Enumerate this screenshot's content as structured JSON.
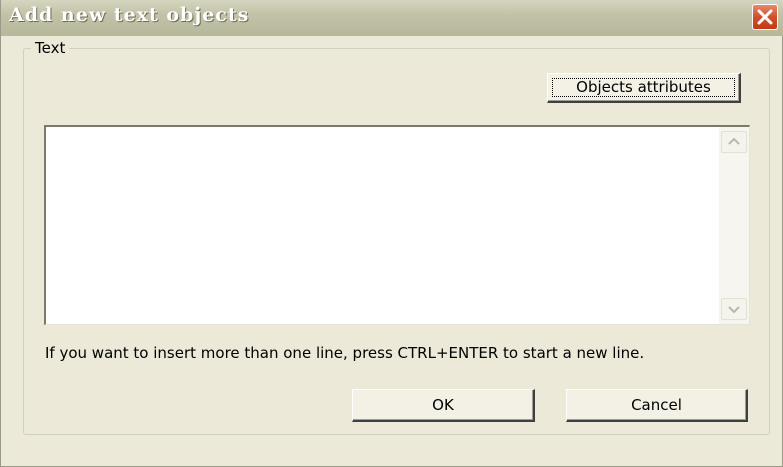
{
  "window": {
    "title": "Add new text objects"
  },
  "group": {
    "legend": "Text"
  },
  "buttons": {
    "objects_attributes": "Objects attributes",
    "ok": "OK",
    "cancel": "Cancel"
  },
  "editor": {
    "value": ""
  },
  "hint": "If you want to insert more than one line, press CTRL+ENTER to start a new line.",
  "icons": {
    "close": "close-icon",
    "scroll_up": "scroll-up-icon",
    "scroll_down": "scroll-down-icon"
  },
  "colors": {
    "dialog_background": "#ece9d8",
    "close_button": "#d2502c",
    "titlebar": "#c2c2a8"
  }
}
